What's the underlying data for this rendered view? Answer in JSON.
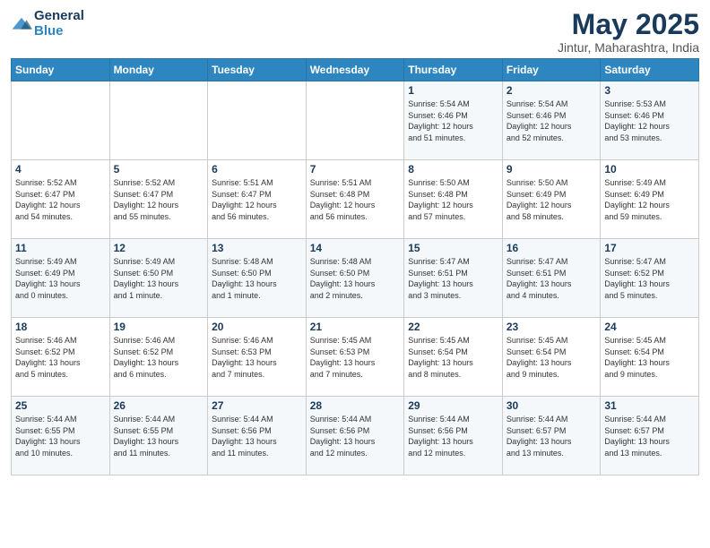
{
  "header": {
    "logo_line1": "General",
    "logo_line2": "Blue",
    "month_year": "May 2025",
    "location": "Jintur, Maharashtra, India"
  },
  "days_of_week": [
    "Sunday",
    "Monday",
    "Tuesday",
    "Wednesday",
    "Thursday",
    "Friday",
    "Saturday"
  ],
  "weeks": [
    [
      {
        "day": "",
        "info": ""
      },
      {
        "day": "",
        "info": ""
      },
      {
        "day": "",
        "info": ""
      },
      {
        "day": "",
        "info": ""
      },
      {
        "day": "1",
        "info": "Sunrise: 5:54 AM\nSunset: 6:46 PM\nDaylight: 12 hours\nand 51 minutes."
      },
      {
        "day": "2",
        "info": "Sunrise: 5:54 AM\nSunset: 6:46 PM\nDaylight: 12 hours\nand 52 minutes."
      },
      {
        "day": "3",
        "info": "Sunrise: 5:53 AM\nSunset: 6:46 PM\nDaylight: 12 hours\nand 53 minutes."
      }
    ],
    [
      {
        "day": "4",
        "info": "Sunrise: 5:52 AM\nSunset: 6:47 PM\nDaylight: 12 hours\nand 54 minutes."
      },
      {
        "day": "5",
        "info": "Sunrise: 5:52 AM\nSunset: 6:47 PM\nDaylight: 12 hours\nand 55 minutes."
      },
      {
        "day": "6",
        "info": "Sunrise: 5:51 AM\nSunset: 6:47 PM\nDaylight: 12 hours\nand 56 minutes."
      },
      {
        "day": "7",
        "info": "Sunrise: 5:51 AM\nSunset: 6:48 PM\nDaylight: 12 hours\nand 56 minutes."
      },
      {
        "day": "8",
        "info": "Sunrise: 5:50 AM\nSunset: 6:48 PM\nDaylight: 12 hours\nand 57 minutes."
      },
      {
        "day": "9",
        "info": "Sunrise: 5:50 AM\nSunset: 6:49 PM\nDaylight: 12 hours\nand 58 minutes."
      },
      {
        "day": "10",
        "info": "Sunrise: 5:49 AM\nSunset: 6:49 PM\nDaylight: 12 hours\nand 59 minutes."
      }
    ],
    [
      {
        "day": "11",
        "info": "Sunrise: 5:49 AM\nSunset: 6:49 PM\nDaylight: 13 hours\nand 0 minutes."
      },
      {
        "day": "12",
        "info": "Sunrise: 5:49 AM\nSunset: 6:50 PM\nDaylight: 13 hours\nand 1 minute."
      },
      {
        "day": "13",
        "info": "Sunrise: 5:48 AM\nSunset: 6:50 PM\nDaylight: 13 hours\nand 1 minute."
      },
      {
        "day": "14",
        "info": "Sunrise: 5:48 AM\nSunset: 6:50 PM\nDaylight: 13 hours\nand 2 minutes."
      },
      {
        "day": "15",
        "info": "Sunrise: 5:47 AM\nSunset: 6:51 PM\nDaylight: 13 hours\nand 3 minutes."
      },
      {
        "day": "16",
        "info": "Sunrise: 5:47 AM\nSunset: 6:51 PM\nDaylight: 13 hours\nand 4 minutes."
      },
      {
        "day": "17",
        "info": "Sunrise: 5:47 AM\nSunset: 6:52 PM\nDaylight: 13 hours\nand 5 minutes."
      }
    ],
    [
      {
        "day": "18",
        "info": "Sunrise: 5:46 AM\nSunset: 6:52 PM\nDaylight: 13 hours\nand 5 minutes."
      },
      {
        "day": "19",
        "info": "Sunrise: 5:46 AM\nSunset: 6:52 PM\nDaylight: 13 hours\nand 6 minutes."
      },
      {
        "day": "20",
        "info": "Sunrise: 5:46 AM\nSunset: 6:53 PM\nDaylight: 13 hours\nand 7 minutes."
      },
      {
        "day": "21",
        "info": "Sunrise: 5:45 AM\nSunset: 6:53 PM\nDaylight: 13 hours\nand 7 minutes."
      },
      {
        "day": "22",
        "info": "Sunrise: 5:45 AM\nSunset: 6:54 PM\nDaylight: 13 hours\nand 8 minutes."
      },
      {
        "day": "23",
        "info": "Sunrise: 5:45 AM\nSunset: 6:54 PM\nDaylight: 13 hours\nand 9 minutes."
      },
      {
        "day": "24",
        "info": "Sunrise: 5:45 AM\nSunset: 6:54 PM\nDaylight: 13 hours\nand 9 minutes."
      }
    ],
    [
      {
        "day": "25",
        "info": "Sunrise: 5:44 AM\nSunset: 6:55 PM\nDaylight: 13 hours\nand 10 minutes."
      },
      {
        "day": "26",
        "info": "Sunrise: 5:44 AM\nSunset: 6:55 PM\nDaylight: 13 hours\nand 11 minutes."
      },
      {
        "day": "27",
        "info": "Sunrise: 5:44 AM\nSunset: 6:56 PM\nDaylight: 13 hours\nand 11 minutes."
      },
      {
        "day": "28",
        "info": "Sunrise: 5:44 AM\nSunset: 6:56 PM\nDaylight: 13 hours\nand 12 minutes."
      },
      {
        "day": "29",
        "info": "Sunrise: 5:44 AM\nSunset: 6:56 PM\nDaylight: 13 hours\nand 12 minutes."
      },
      {
        "day": "30",
        "info": "Sunrise: 5:44 AM\nSunset: 6:57 PM\nDaylight: 13 hours\nand 13 minutes."
      },
      {
        "day": "31",
        "info": "Sunrise: 5:44 AM\nSunset: 6:57 PM\nDaylight: 13 hours\nand 13 minutes."
      }
    ]
  ]
}
